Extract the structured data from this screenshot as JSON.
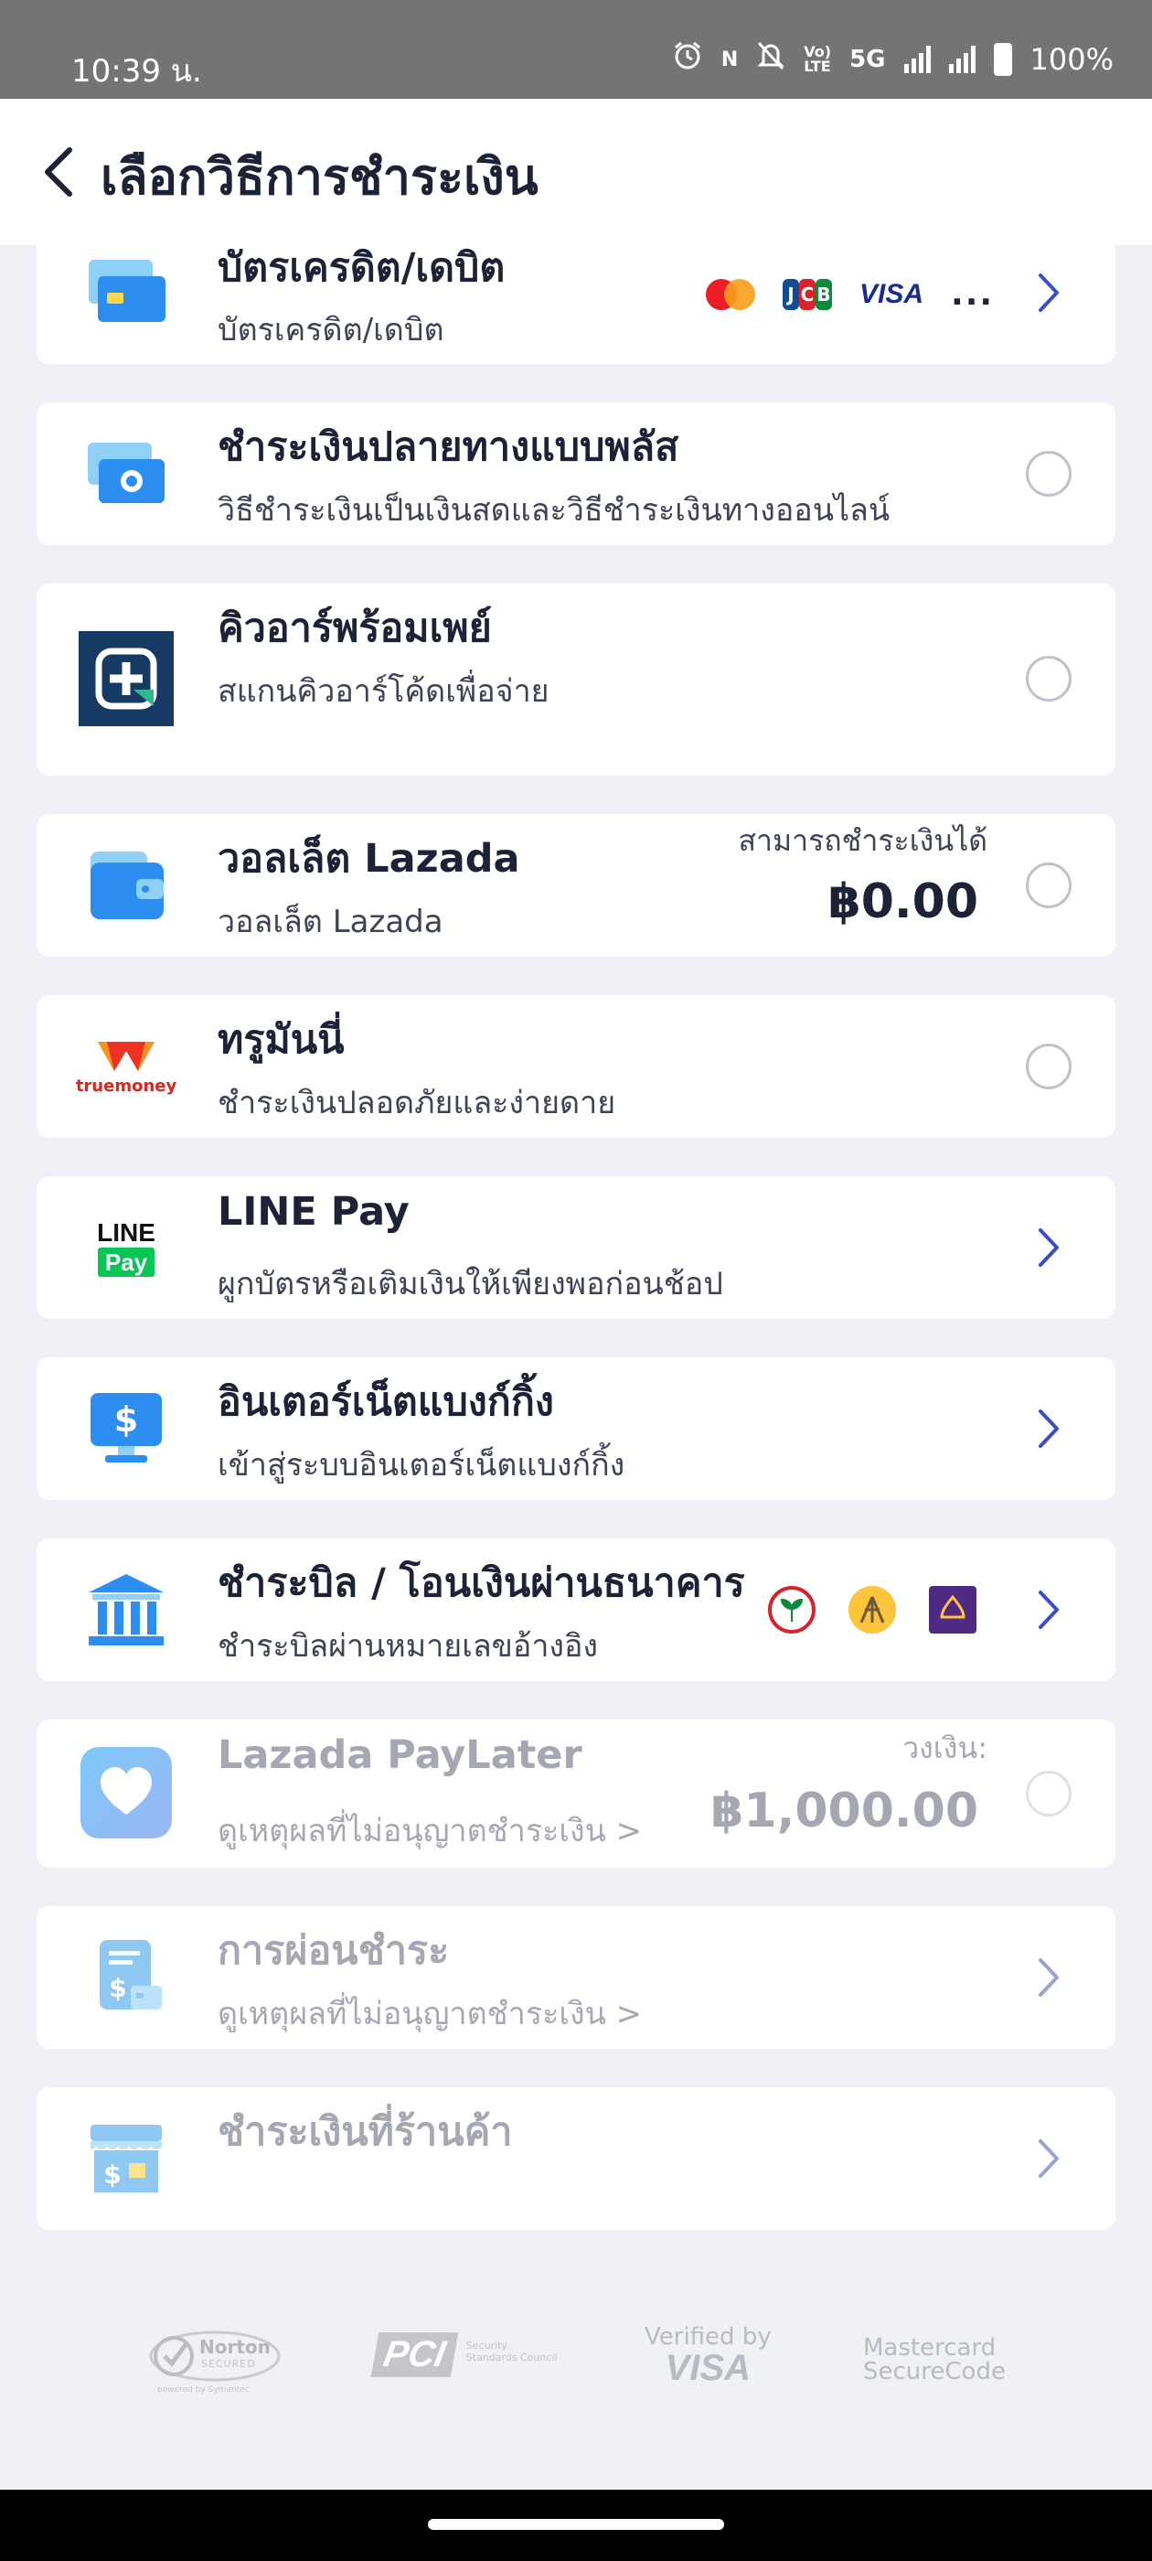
{
  "status_bar": {
    "time": "10:39 น.",
    "network": "5G",
    "lte": "LTE",
    "volte": "Vo)",
    "nfc": "N",
    "battery": "100%",
    "icons": [
      "alarm-icon",
      "nfc-icon",
      "mute-icon",
      "volte-icon",
      "signal-icon",
      "battery-icon"
    ]
  },
  "header": {
    "title": "เลือกวิธีการชำระเงิน",
    "back_icon": "chevron-left-icon"
  },
  "methods": [
    {
      "title": "บัตรเครดิต/เดบิต",
      "subtitle": "บัตรเครดิต/เดบิต",
      "icon": "credit-card-icon",
      "action": "chevron",
      "card_logos": {
        "visa": "VISA",
        "jcb": [
          "J",
          "C",
          "B"
        ],
        "more": "..."
      }
    },
    {
      "title": "ชำระเงินปลายทางแบบพลัส",
      "subtitle": "วิธีชำระเงินเป็นเงินสดและวิธีชำระเงินทางออนไลน์",
      "icon": "cash-icon",
      "action": "radio"
    },
    {
      "title": "คิวอาร์พร้อมเพย์",
      "subtitle": "สแกนคิวอาร์โค้ดเพื่อจ่าย",
      "icon": "promptpay-qr-icon",
      "action": "radio"
    },
    {
      "title": "วอลเล็ต Lazada",
      "subtitle": "วอลเล็ต Lazada",
      "icon": "wallet-icon",
      "action": "radio",
      "balance_label": "สามารถชำระเงินได้",
      "balance": "฿0.00"
    },
    {
      "title": "ทรูมันนี่",
      "subtitle": "ชำระเงินปลอดภัยและง่ายดาย",
      "icon": "truemoney-icon",
      "icon_text": "truemoney",
      "action": "radio"
    },
    {
      "title": "LINE Pay",
      "subtitle": "ผูกบัตรหรือเติมเงินให้เพียงพอก่อนช้อป",
      "icon": "line-pay-icon",
      "icon_text_top": "LINE",
      "icon_text_bottom": "Pay",
      "action": "chevron"
    },
    {
      "title": "อินเตอร์เน็ตแบงก์กิ้ง",
      "subtitle": "เข้าสู่ระบบอินเตอร์เน็ตแบงก์กิ้ง",
      "icon": "internet-banking-icon",
      "action": "chevron"
    },
    {
      "title": "ชำระบิล / โอนเงินผ่านธนาคาร",
      "subtitle": "ชำระบิลผ่านหมายเลขอ้างอิง",
      "icon": "bank-icon",
      "action": "chevron",
      "bank_logos": [
        "kasikorn-bank-icon",
        "krungsri-bank-icon",
        "scb-bank-icon"
      ]
    },
    {
      "title": "Lazada PayLater",
      "subtitle": "ดูเหตุผลที่ไม่อนุญาตชำระเงิน >",
      "icon": "paylater-heart-icon",
      "action": "radio",
      "disabled": true,
      "balance_label": "วงเงิน:",
      "balance": "฿1,000.00"
    },
    {
      "title": "การผ่อนชำระ",
      "subtitle": "ดูเหตุผลที่ไม่อนุญาตชำระเงิน >",
      "icon": "installment-icon",
      "action": "chevron",
      "disabled": true
    },
    {
      "title": "ชำระเงินที่ร้านค้า",
      "subtitle": "",
      "icon": "store-icon",
      "action": "chevron",
      "disabled": true
    }
  ],
  "trust_badges": {
    "norton": {
      "name": "Norton",
      "line2": "SECURED",
      "line3": "powered by Symantec"
    },
    "pci": {
      "name": "PCI",
      "line2": "Security",
      "line3": "Standards Council"
    },
    "visa": {
      "line1": "Verified by",
      "line2": "VISA"
    },
    "mastercard": {
      "line1": "Mastercard",
      "line2": "SecureCode"
    }
  },
  "colors": {
    "accent": "#3b4bd0",
    "title_text": "#1d2236",
    "disabled_text": "#a5a8b3",
    "background": "#f0f1f6",
    "icon_blue": "#2b8ef0"
  }
}
